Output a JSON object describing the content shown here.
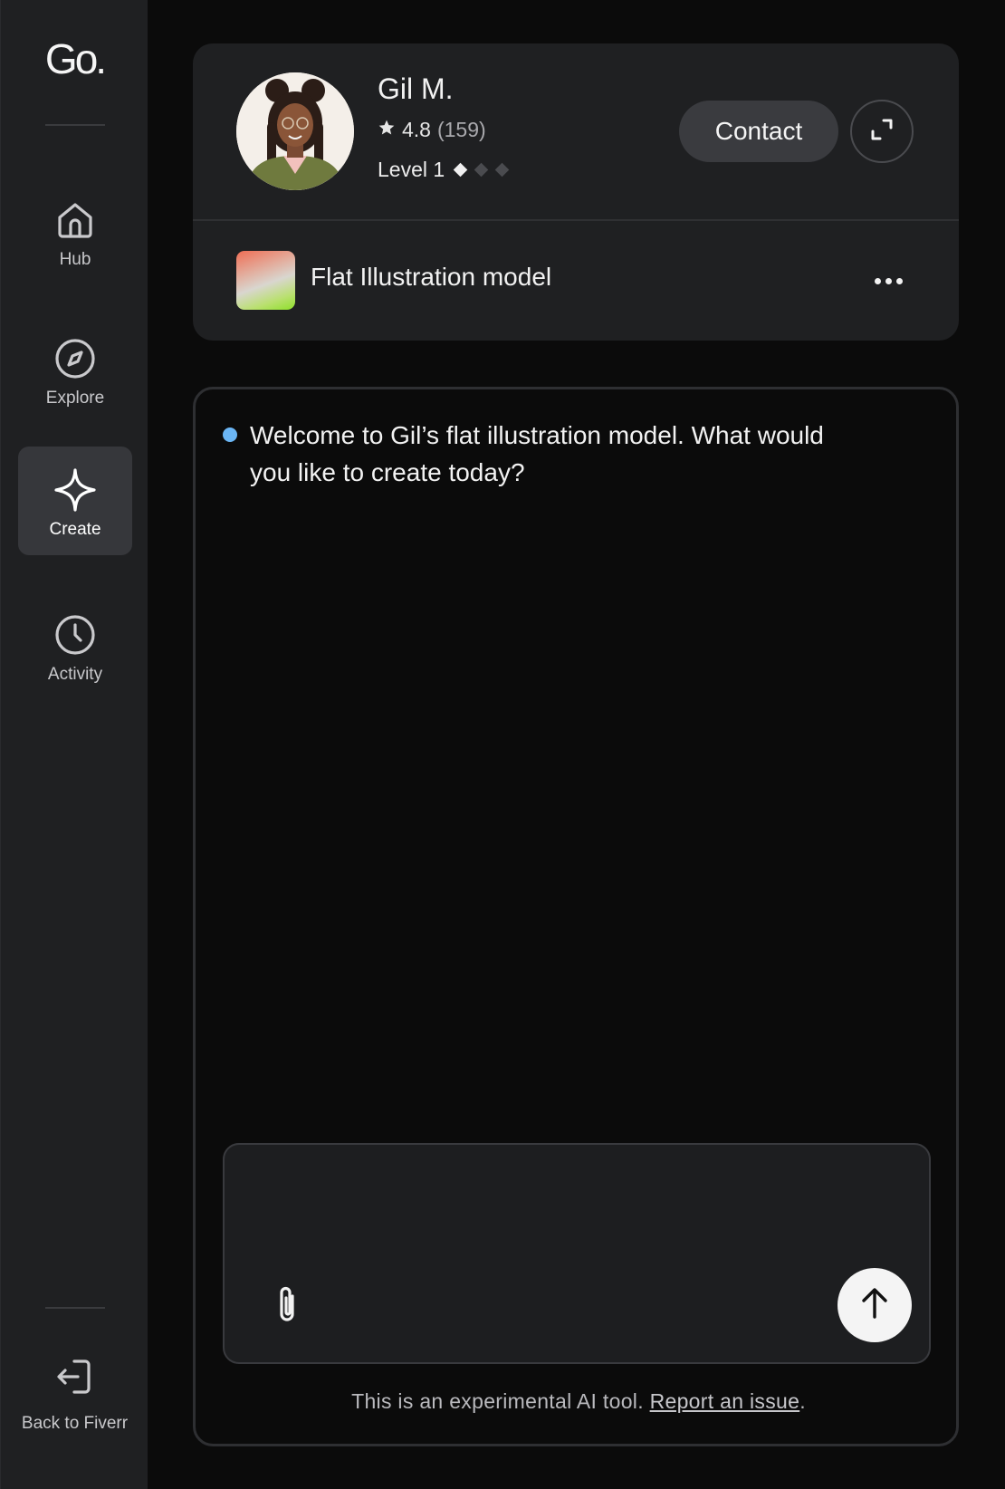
{
  "sidebar": {
    "logo": "Go.",
    "items": [
      {
        "label": "Hub",
        "icon": "home-icon"
      },
      {
        "label": "Explore",
        "icon": "compass-icon"
      },
      {
        "label": "Create",
        "icon": "sparkle-icon",
        "active": true
      },
      {
        "label": "Activity",
        "icon": "clock-icon"
      }
    ],
    "back_label": "Back to Fiverr",
    "back_icon": "sign-out-icon"
  },
  "seller": {
    "name": "Gil M.",
    "rating": "4.8",
    "review_count": "(159)",
    "level": "Level 1",
    "level_filled": 1,
    "level_total": 3,
    "contact_label": "Contact"
  },
  "model": {
    "name": "Flat Illustration model"
  },
  "chat": {
    "welcome_message": "Welcome to Gil’s flat illustration model. What would you like to create today?",
    "input_value": "",
    "disclaimer_text": "This is an experimental AI tool. ",
    "report_link": "Report an issue",
    "disclaimer_end": "."
  },
  "colors": {
    "accent_dot": "#6bb6f5",
    "background": "#0b0b0b",
    "panel": "#1f2022"
  }
}
